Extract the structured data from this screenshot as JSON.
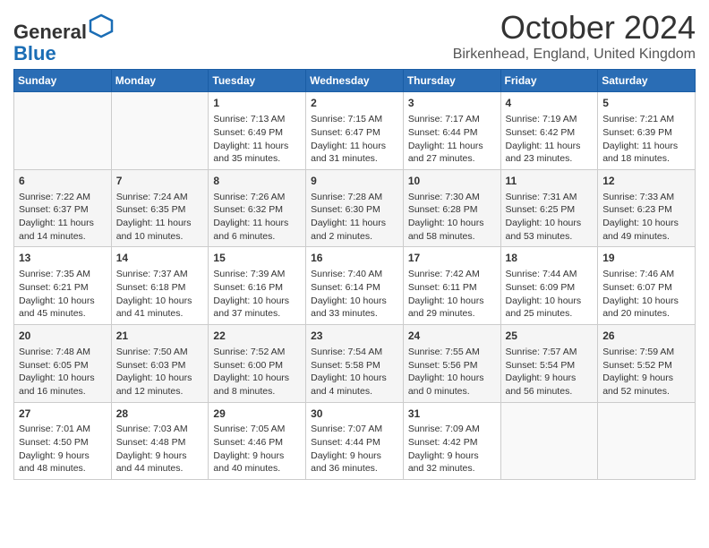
{
  "header": {
    "logo_general": "General",
    "logo_blue": "Blue",
    "month_title": "October 2024",
    "location": "Birkenhead, England, United Kingdom"
  },
  "days_of_week": [
    "Sunday",
    "Monday",
    "Tuesday",
    "Wednesday",
    "Thursday",
    "Friday",
    "Saturday"
  ],
  "weeks": [
    [
      {
        "day": "",
        "info": ""
      },
      {
        "day": "",
        "info": ""
      },
      {
        "day": "1",
        "info": "Sunrise: 7:13 AM\nSunset: 6:49 PM\nDaylight: 11 hours and 35 minutes."
      },
      {
        "day": "2",
        "info": "Sunrise: 7:15 AM\nSunset: 6:47 PM\nDaylight: 11 hours and 31 minutes."
      },
      {
        "day": "3",
        "info": "Sunrise: 7:17 AM\nSunset: 6:44 PM\nDaylight: 11 hours and 27 minutes."
      },
      {
        "day": "4",
        "info": "Sunrise: 7:19 AM\nSunset: 6:42 PM\nDaylight: 11 hours and 23 minutes."
      },
      {
        "day": "5",
        "info": "Sunrise: 7:21 AM\nSunset: 6:39 PM\nDaylight: 11 hours and 18 minutes."
      }
    ],
    [
      {
        "day": "6",
        "info": "Sunrise: 7:22 AM\nSunset: 6:37 PM\nDaylight: 11 hours and 14 minutes."
      },
      {
        "day": "7",
        "info": "Sunrise: 7:24 AM\nSunset: 6:35 PM\nDaylight: 11 hours and 10 minutes."
      },
      {
        "day": "8",
        "info": "Sunrise: 7:26 AM\nSunset: 6:32 PM\nDaylight: 11 hours and 6 minutes."
      },
      {
        "day": "9",
        "info": "Sunrise: 7:28 AM\nSunset: 6:30 PM\nDaylight: 11 hours and 2 minutes."
      },
      {
        "day": "10",
        "info": "Sunrise: 7:30 AM\nSunset: 6:28 PM\nDaylight: 10 hours and 58 minutes."
      },
      {
        "day": "11",
        "info": "Sunrise: 7:31 AM\nSunset: 6:25 PM\nDaylight: 10 hours and 53 minutes."
      },
      {
        "day": "12",
        "info": "Sunrise: 7:33 AM\nSunset: 6:23 PM\nDaylight: 10 hours and 49 minutes."
      }
    ],
    [
      {
        "day": "13",
        "info": "Sunrise: 7:35 AM\nSunset: 6:21 PM\nDaylight: 10 hours and 45 minutes."
      },
      {
        "day": "14",
        "info": "Sunrise: 7:37 AM\nSunset: 6:18 PM\nDaylight: 10 hours and 41 minutes."
      },
      {
        "day": "15",
        "info": "Sunrise: 7:39 AM\nSunset: 6:16 PM\nDaylight: 10 hours and 37 minutes."
      },
      {
        "day": "16",
        "info": "Sunrise: 7:40 AM\nSunset: 6:14 PM\nDaylight: 10 hours and 33 minutes."
      },
      {
        "day": "17",
        "info": "Sunrise: 7:42 AM\nSunset: 6:11 PM\nDaylight: 10 hours and 29 minutes."
      },
      {
        "day": "18",
        "info": "Sunrise: 7:44 AM\nSunset: 6:09 PM\nDaylight: 10 hours and 25 minutes."
      },
      {
        "day": "19",
        "info": "Sunrise: 7:46 AM\nSunset: 6:07 PM\nDaylight: 10 hours and 20 minutes."
      }
    ],
    [
      {
        "day": "20",
        "info": "Sunrise: 7:48 AM\nSunset: 6:05 PM\nDaylight: 10 hours and 16 minutes."
      },
      {
        "day": "21",
        "info": "Sunrise: 7:50 AM\nSunset: 6:03 PM\nDaylight: 10 hours and 12 minutes."
      },
      {
        "day": "22",
        "info": "Sunrise: 7:52 AM\nSunset: 6:00 PM\nDaylight: 10 hours and 8 minutes."
      },
      {
        "day": "23",
        "info": "Sunrise: 7:54 AM\nSunset: 5:58 PM\nDaylight: 10 hours and 4 minutes."
      },
      {
        "day": "24",
        "info": "Sunrise: 7:55 AM\nSunset: 5:56 PM\nDaylight: 10 hours and 0 minutes."
      },
      {
        "day": "25",
        "info": "Sunrise: 7:57 AM\nSunset: 5:54 PM\nDaylight: 9 hours and 56 minutes."
      },
      {
        "day": "26",
        "info": "Sunrise: 7:59 AM\nSunset: 5:52 PM\nDaylight: 9 hours and 52 minutes."
      }
    ],
    [
      {
        "day": "27",
        "info": "Sunrise: 7:01 AM\nSunset: 4:50 PM\nDaylight: 9 hours and 48 minutes."
      },
      {
        "day": "28",
        "info": "Sunrise: 7:03 AM\nSunset: 4:48 PM\nDaylight: 9 hours and 44 minutes."
      },
      {
        "day": "29",
        "info": "Sunrise: 7:05 AM\nSunset: 4:46 PM\nDaylight: 9 hours and 40 minutes."
      },
      {
        "day": "30",
        "info": "Sunrise: 7:07 AM\nSunset: 4:44 PM\nDaylight: 9 hours and 36 minutes."
      },
      {
        "day": "31",
        "info": "Sunrise: 7:09 AM\nSunset: 4:42 PM\nDaylight: 9 hours and 32 minutes."
      },
      {
        "day": "",
        "info": ""
      },
      {
        "day": "",
        "info": ""
      }
    ]
  ]
}
